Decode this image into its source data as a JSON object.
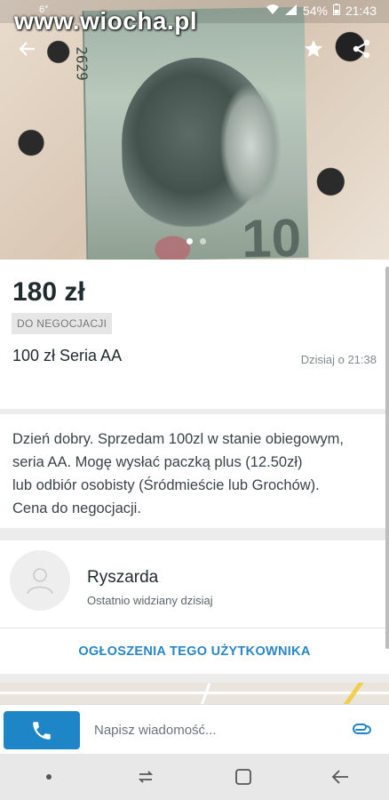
{
  "status_bar": {
    "small_left": "6°",
    "battery": "54%",
    "time": "21:43"
  },
  "watermark": "www.wiocha.pl",
  "photo": {
    "serial_fragment": "2629",
    "big_digit": "10"
  },
  "listing": {
    "price": "180 zł",
    "negotiation_badge": "DO NEGOCJACJI",
    "title": "100 zł Seria AA",
    "posted": "Dzisiaj o 21:38",
    "description_lines": [
      "Dzień dobry. Sprzedam 100zl w stanie obiegowym,",
      "seria AA. Mogę wysłać paczką plus (12.50zł)",
      "lub odbiór osobisty (Śródmieście lub Grochów).",
      "Cena do negocjacji."
    ]
  },
  "seller": {
    "name": "Ryszarda",
    "last_seen": "Ostatnio widziany dzisiaj",
    "ads_link": "OGŁOSZENIA TEGO UŻYTKOWNIKA"
  },
  "composer": {
    "placeholder": "Napisz wiadomość..."
  },
  "icons": {
    "back": "arrow-left-icon",
    "favorite": "star-icon",
    "share": "share-icon",
    "call": "phone-icon",
    "attach": "paperclip-icon"
  },
  "colors": {
    "accent": "#1e86c7",
    "link": "#2a86c4"
  }
}
